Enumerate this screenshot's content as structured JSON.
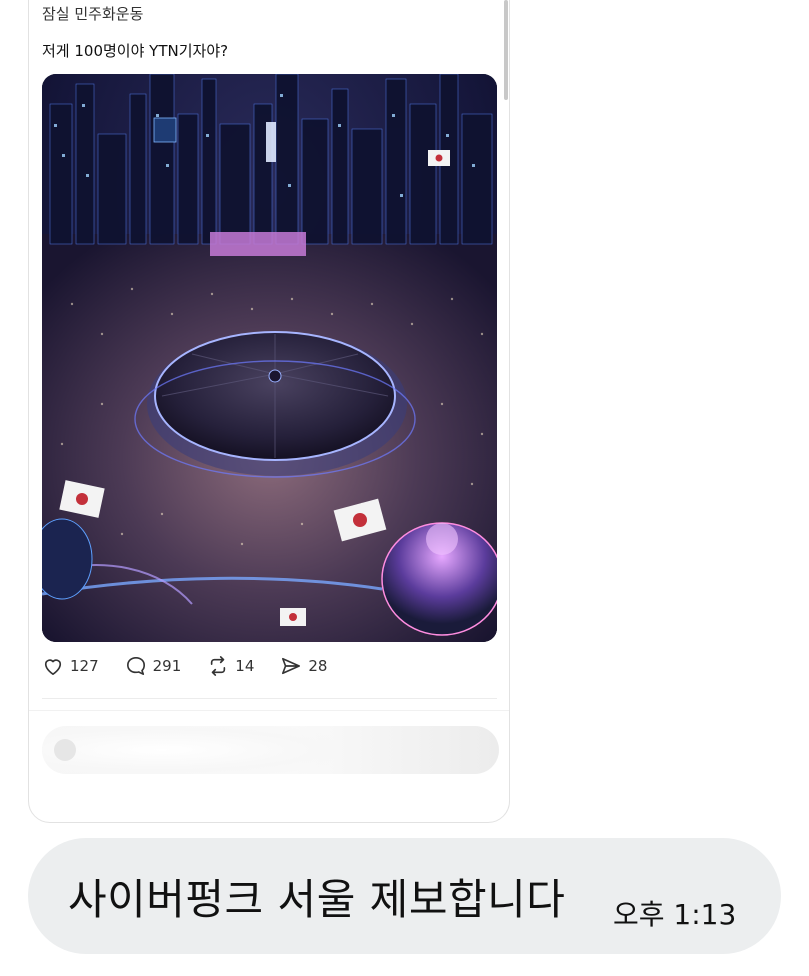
{
  "post": {
    "author": "잠실 민주화운동",
    "text": "저게 100명이야 YTN기자야?",
    "image_description": "cyberpunk-seoul-crowd-image",
    "actions": {
      "likes": "127",
      "replies": "291",
      "reposts": "14",
      "shares": "28"
    }
  },
  "chat": {
    "message": "사이버펑크 서울 제보합니다",
    "time": "오후 1:13"
  },
  "colors": {
    "bubble": "#eceeef",
    "card_border": "#e2e2e2"
  }
}
